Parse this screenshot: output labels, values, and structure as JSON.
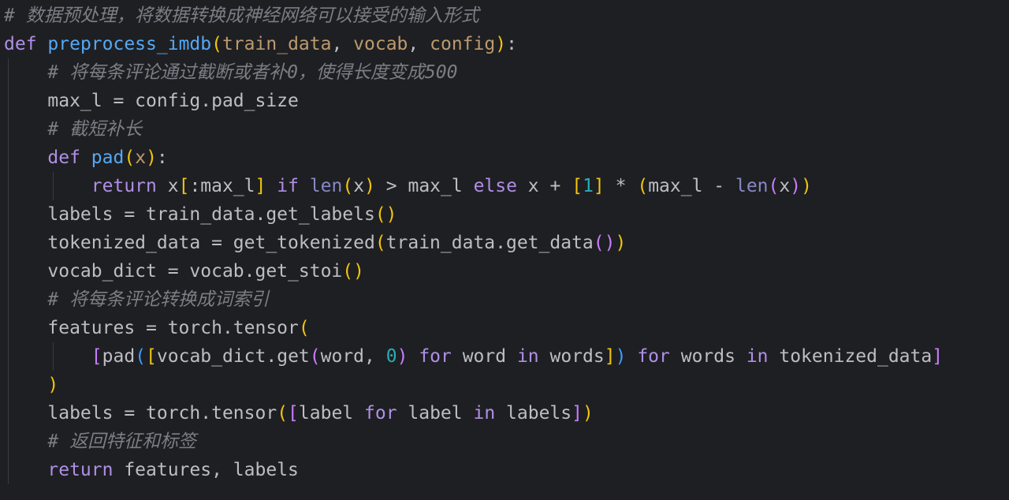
{
  "code": {
    "language": "python",
    "lines": [
      {
        "tokens": [
          {
            "t": "# 数据预处理，将数据转换成神经网络可以接受的输入形式",
            "c": "c"
          }
        ]
      },
      {
        "tokens": [
          {
            "t": "def",
            "c": "kw"
          },
          {
            "t": " "
          },
          {
            "t": "preprocess_imdb",
            "c": "f"
          },
          {
            "t": "(",
            "c": "y"
          },
          {
            "t": "train_data",
            "c": "pa"
          },
          {
            "t": ", "
          },
          {
            "t": "vocab",
            "c": "pa"
          },
          {
            "t": ", "
          },
          {
            "t": "config",
            "c": "pa"
          },
          {
            "t": ")",
            "c": "y"
          },
          {
            "t": ":"
          }
        ]
      },
      {
        "tokens": [
          {
            "t": "    "
          },
          {
            "t": "# 将每条评论通过截断或者补0，使得长度变成500",
            "c": "c"
          }
        ]
      },
      {
        "tokens": [
          {
            "t": "    max_l = config.pad_size"
          }
        ]
      },
      {
        "tokens": [
          {
            "t": "    "
          },
          {
            "t": "# 截短补长",
            "c": "c"
          }
        ]
      },
      {
        "tokens": [
          {
            "t": "    "
          },
          {
            "t": "def",
            "c": "kw"
          },
          {
            "t": " "
          },
          {
            "t": "pad",
            "c": "f"
          },
          {
            "t": "(",
            "c": "y"
          },
          {
            "t": "x",
            "c": "pa"
          },
          {
            "t": ")",
            "c": "y"
          },
          {
            "t": ":"
          }
        ]
      },
      {
        "tokens": [
          {
            "t": "        "
          },
          {
            "t": "return",
            "c": "kw"
          },
          {
            "t": " x"
          },
          {
            "t": "[",
            "c": "y"
          },
          {
            "t": ":max_l"
          },
          {
            "t": "]",
            "c": "y"
          },
          {
            "t": " "
          },
          {
            "t": "if",
            "c": "kw"
          },
          {
            "t": " "
          },
          {
            "t": "len",
            "c": "bi"
          },
          {
            "t": "(",
            "c": "y"
          },
          {
            "t": "x"
          },
          {
            "t": ")",
            "c": "y"
          },
          {
            "t": " > max_l "
          },
          {
            "t": "else",
            "c": "kw"
          },
          {
            "t": " x + "
          },
          {
            "t": "[",
            "c": "y"
          },
          {
            "t": "1",
            "c": "n"
          },
          {
            "t": "]",
            "c": "y"
          },
          {
            "t": " * "
          },
          {
            "t": "(",
            "c": "y"
          },
          {
            "t": "max_l - "
          },
          {
            "t": "len",
            "c": "bi"
          },
          {
            "t": "(",
            "c": "m"
          },
          {
            "t": "x"
          },
          {
            "t": ")",
            "c": "m"
          },
          {
            "t": ")",
            "c": "y"
          }
        ]
      },
      {
        "tokens": [
          {
            "t": "    labels = train_data.get_labels"
          },
          {
            "t": "()",
            "c": "y"
          }
        ]
      },
      {
        "tokens": [
          {
            "t": "    tokenized_data = get_tokenized"
          },
          {
            "t": "(",
            "c": "y"
          },
          {
            "t": "train_data.get_data"
          },
          {
            "t": "()",
            "c": "m"
          },
          {
            "t": ")",
            "c": "y"
          }
        ]
      },
      {
        "tokens": [
          {
            "t": "    vocab_dict = vocab.get_stoi"
          },
          {
            "t": "()",
            "c": "y"
          }
        ]
      },
      {
        "tokens": [
          {
            "t": "    "
          },
          {
            "t": "# 将每条评论转换成词索引",
            "c": "c"
          }
        ]
      },
      {
        "tokens": [
          {
            "t": "    features = torch.tensor"
          },
          {
            "t": "(",
            "c": "y"
          }
        ]
      },
      {
        "tokens": [
          {
            "t": "        "
          },
          {
            "t": "[",
            "c": "m"
          },
          {
            "t": "pad"
          },
          {
            "t": "(",
            "c": "b"
          },
          {
            "t": "[",
            "c": "y"
          },
          {
            "t": "vocab_dict.get"
          },
          {
            "t": "(",
            "c": "m"
          },
          {
            "t": "word, "
          },
          {
            "t": "0",
            "c": "n"
          },
          {
            "t": ")",
            "c": "m"
          },
          {
            "t": " "
          },
          {
            "t": "for",
            "c": "kw"
          },
          {
            "t": " word "
          },
          {
            "t": "in",
            "c": "kw"
          },
          {
            "t": " words"
          },
          {
            "t": "]",
            "c": "y"
          },
          {
            "t": ")",
            "c": "b"
          },
          {
            "t": " "
          },
          {
            "t": "for",
            "c": "kw"
          },
          {
            "t": " words "
          },
          {
            "t": "in",
            "c": "kw"
          },
          {
            "t": " tokenized_data"
          },
          {
            "t": "]",
            "c": "m"
          }
        ]
      },
      {
        "tokens": [
          {
            "t": "    "
          },
          {
            "t": ")",
            "c": "y"
          }
        ]
      },
      {
        "tokens": [
          {
            "t": "    labels = torch.tensor"
          },
          {
            "t": "(",
            "c": "y"
          },
          {
            "t": "[",
            "c": "m"
          },
          {
            "t": "label "
          },
          {
            "t": "for",
            "c": "kw"
          },
          {
            "t": " label "
          },
          {
            "t": "in",
            "c": "kw"
          },
          {
            "t": " labels"
          },
          {
            "t": "]",
            "c": "m"
          },
          {
            "t": ")",
            "c": "y"
          }
        ]
      },
      {
        "tokens": [
          {
            "t": "    "
          },
          {
            "t": "# 返回特征和标签",
            "c": "c"
          }
        ]
      },
      {
        "tokens": [
          {
            "t": "    "
          },
          {
            "t": "return",
            "c": "kw"
          },
          {
            "t": " features, labels"
          }
        ]
      }
    ]
  },
  "colors": {
    "background": "#1e1f22",
    "comment": "#7a7e85",
    "keyword": "#b08fe6",
    "function": "#56a8f5",
    "parameter": "#bc9a6d",
    "number": "#2aacb8",
    "bracket_1": "#f1c40f",
    "bracket_2": "#c77dff",
    "bracket_3": "#3d9cff",
    "text": "#bcbec4"
  }
}
